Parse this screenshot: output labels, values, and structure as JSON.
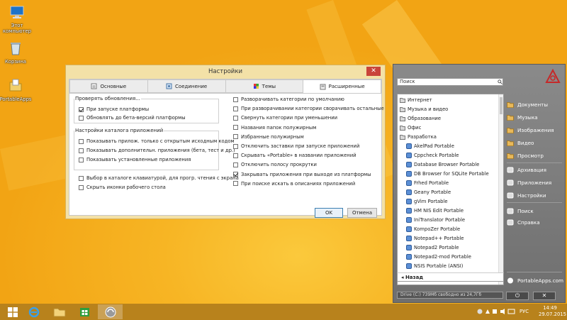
{
  "desktop": {
    "icons": [
      {
        "label": "Этот компьютер",
        "icon": "computer-icon"
      },
      {
        "label": "Корзина",
        "icon": "recycle-bin-icon"
      },
      {
        "label": "PortableApps",
        "icon": "folder-icon"
      }
    ]
  },
  "settings": {
    "title": "Настройки",
    "close": "✕",
    "tabs": [
      {
        "label": "Основные",
        "icon": "general-icon"
      },
      {
        "label": "Соединение",
        "icon": "connection-icon"
      },
      {
        "label": "Темы",
        "icon": "themes-icon"
      },
      {
        "label": "Расширенные",
        "icon": "advanced-icon"
      }
    ],
    "active_tab": "Расширенные",
    "updates_group": {
      "label": "Проверять обновления...",
      "items": [
        {
          "label": "При запуске платформы",
          "checked": true
        },
        {
          "label": "Обновлять до бета-версий платформы",
          "checked": false
        }
      ]
    },
    "catalog_group": {
      "label": "Настройки каталога приложений",
      "items": [
        {
          "label": "Показывать прилож. только с открытым исходным кодом",
          "checked": false
        },
        {
          "label": "Показывать дополнительн. приложения (бета, тест и др.)",
          "checked": false
        },
        {
          "label": "Показывать установленные приложения",
          "checked": false
        }
      ]
    },
    "left_extra": [
      {
        "label": "Выбор в каталоге клавиатурой, для прогр. чтения с экрана",
        "checked": false
      },
      {
        "label": "Скрыть иконки рабочего стола",
        "checked": false
      }
    ],
    "right_items": [
      {
        "label": "Разворачивать категории по умолчанию",
        "checked": false
      },
      {
        "label": "При разворачивании категории сворачивать остальные",
        "checked": false
      },
      {
        "label": "Свернуть категории при уменьшении",
        "checked": false
      },
      {
        "label": "Названия папок полужирным",
        "checked": false
      },
      {
        "label": "Избранные полужирным",
        "checked": false
      },
      {
        "label": "Отключить заставки при запуске приложений",
        "checked": false
      },
      {
        "label": "Скрывать «Portable» в названии приложений",
        "checked": false
      },
      {
        "label": "Отключить полосу прокрутки",
        "checked": false
      },
      {
        "label": "Закрывать приложения при выходе из платформы",
        "checked": true
      },
      {
        "label": "При поиске искать в описаниях приложений",
        "checked": false
      }
    ],
    "ok": "OK",
    "cancel": "Отмена"
  },
  "portable": {
    "search_placeholder": "Поиск",
    "list": [
      {
        "label": "Интернет",
        "indent": 0,
        "icon": "category-icon"
      },
      {
        "label": "Музыка и видео",
        "indent": 0,
        "icon": "category-icon"
      },
      {
        "label": "Образование",
        "indent": 0,
        "icon": "category-icon"
      },
      {
        "label": "Офис",
        "indent": 0,
        "icon": "category-icon"
      },
      {
        "label": "Разработка",
        "indent": 0,
        "icon": "category-icon"
      },
      {
        "label": "AkelPad Portable",
        "indent": 1,
        "icon": "app-icon"
      },
      {
        "label": "Cppcheck Portable",
        "indent": 1,
        "icon": "app-icon"
      },
      {
        "label": "Database Browser Portable",
        "indent": 1,
        "icon": "app-icon"
      },
      {
        "label": "DB Browser for SQLite Portable",
        "indent": 1,
        "icon": "app-icon"
      },
      {
        "label": "Frhed Portable",
        "indent": 1,
        "icon": "app-icon"
      },
      {
        "label": "Geany Portable",
        "indent": 1,
        "icon": "app-icon"
      },
      {
        "label": "gVim Portable",
        "indent": 1,
        "icon": "app-icon"
      },
      {
        "label": "HM NIS Edit Portable",
        "indent": 1,
        "icon": "app-icon"
      },
      {
        "label": "IniTranslator Portable",
        "indent": 1,
        "icon": "app-icon"
      },
      {
        "label": "KompoZer Portable",
        "indent": 1,
        "icon": "app-icon"
      },
      {
        "label": "Notepad++ Portable",
        "indent": 1,
        "icon": "app-icon"
      },
      {
        "label": "Notepad2 Portable",
        "indent": 1,
        "icon": "app-icon"
      },
      {
        "label": "Notepad2-mod Portable",
        "indent": 1,
        "icon": "app-icon"
      },
      {
        "label": "NSIS Portable (ANSI)",
        "indent": 1,
        "icon": "app-icon"
      }
    ],
    "back": "Назад",
    "drive": "Drive (C:) 739Мб свободно из 24,7Гб",
    "sidebar": [
      {
        "label": "Документы",
        "icon": "folder-icon"
      },
      {
        "label": "Музыка",
        "icon": "folder-icon"
      },
      {
        "label": "Изображения",
        "icon": "folder-icon"
      },
      {
        "label": "Видео",
        "icon": "folder-icon"
      },
      {
        "label": "Просмотр",
        "icon": "folder-icon"
      },
      {
        "label": "Архивация",
        "icon": "archive-icon"
      },
      {
        "label": "Приложения",
        "icon": "apps-icon"
      },
      {
        "label": "Настройки",
        "icon": "settings-icon"
      },
      {
        "label": "Поиск",
        "icon": "search-icon"
      },
      {
        "label": "Справка",
        "icon": "help-icon"
      }
    ],
    "brand": "PortableApps.com",
    "power": "⏻",
    "close": "✕"
  },
  "taskbar": {
    "lang": "РУС",
    "time": "14:49",
    "date": "29.07.2015"
  },
  "colors": {
    "accent": "#f5ad1a",
    "checkbox": "#222222",
    "window_border": "#d8b25a"
  }
}
